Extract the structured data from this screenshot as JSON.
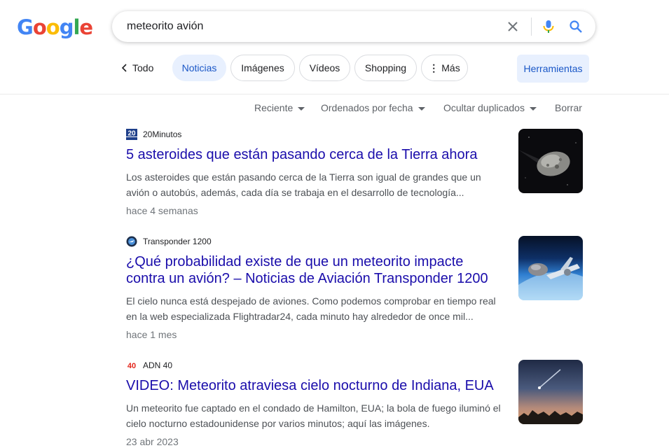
{
  "search": {
    "query": "meteorito avión",
    "icons": [
      "close-icon",
      "microphone-icon",
      "search-icon"
    ]
  },
  "logo": {
    "text": "Google"
  },
  "tabs": {
    "back_label": "Todo",
    "items": [
      {
        "label": "Noticias",
        "active": true
      },
      {
        "label": "Imágenes",
        "active": false
      },
      {
        "label": "Vídeos",
        "active": false
      },
      {
        "label": "Shopping",
        "active": false
      },
      {
        "label": "Más",
        "active": false
      }
    ],
    "tools_label": "Herramientas"
  },
  "filters": {
    "recent": "Reciente",
    "sort": "Ordenados por fecha",
    "duplicates": "Ocultar duplicados",
    "clear": "Borrar"
  },
  "results": [
    {
      "source": "20Minutos",
      "title": "5 asteroides que están pasando cerca de la Tierra ahora",
      "snippet": "Los asteroides que están pasando cerca de la Tierra son igual de grandes que un avión o autobús, además, cada día se trabaja en el desarrollo de tecnología...",
      "age": "hace 4 semanas",
      "thumb": "asteroid-image"
    },
    {
      "source": "Transponder 1200",
      "title": "¿Qué probabilidad existe de que un meteorito impacte contra un avión? – Noticias de Aviación Transponder 1200",
      "snippet": "El cielo nunca está despejado de aviones. Como podemos comprobar en tiempo real en la web especializada Flightradar24, cada minuto hay alrededor de once mil...",
      "age": "hace 1 mes",
      "thumb": "airplane-space-image"
    },
    {
      "source": "ADN 40",
      "title": "VIDEO: Meteorito atraviesa cielo nocturno de Indiana, EUA",
      "snippet": "Un meteorito fue captado en el condado de Hamilton, EUA; la bola de fuego iluminó el cielo nocturno estadounidense por varios minutos; aquí las imágenes.",
      "age": "23 abr 2023",
      "thumb": "night-sky-meteor-image"
    }
  ],
  "colors": {
    "link": "#1a0dab",
    "active_chip": "#e8f0fe",
    "active_text": "#1a57c7"
  }
}
